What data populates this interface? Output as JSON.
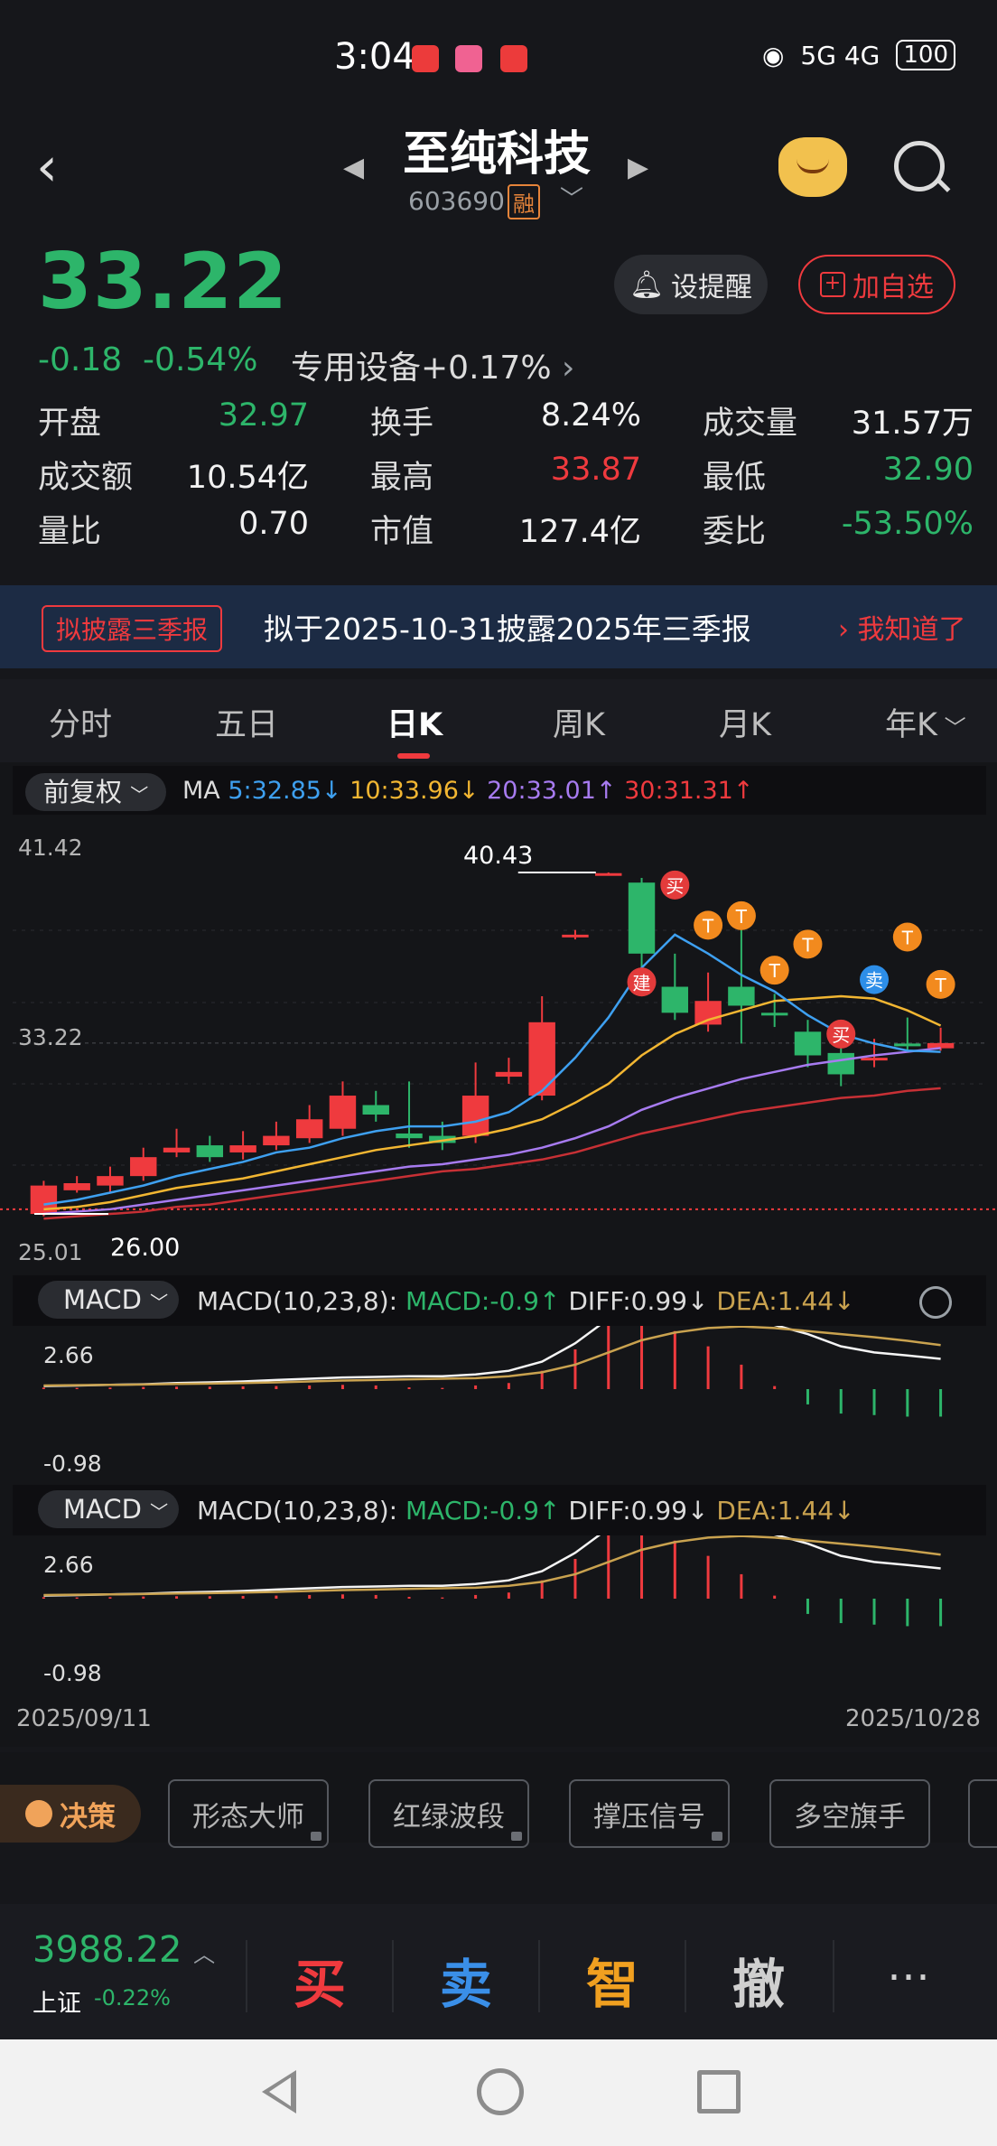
{
  "status_bar": {
    "time": "3:04",
    "network": "5G 4G",
    "battery": "100"
  },
  "header": {
    "stock_name": "至纯科技",
    "stock_code": "603690",
    "margin_badge": "融"
  },
  "quote": {
    "price": "33.22",
    "change": "-0.18",
    "change_pct": "-0.54%",
    "sector": "专用设备",
    "sector_change": "+0.17%",
    "alert_label": "设提醒",
    "watch_label": "加自选"
  },
  "stats": [
    {
      "label": "开盘",
      "value": "32.97",
      "color": "#2db56a"
    },
    {
      "label": "换手",
      "value": "8.24%",
      "color": "#f2f2f2"
    },
    {
      "label": "成交量",
      "value": "31.57万",
      "color": "#f2f2f2"
    },
    {
      "label": "成交额",
      "value": "10.54亿",
      "color": "#f2f2f2"
    },
    {
      "label": "最高",
      "value": "33.87",
      "color": "#ef3a3e"
    },
    {
      "label": "最低",
      "value": "32.90",
      "color": "#2db56a"
    },
    {
      "label": "量比",
      "value": "0.70",
      "color": "#f2f2f2"
    },
    {
      "label": "市值",
      "value": "127.4亿",
      "color": "#f2f2f2"
    },
    {
      "label": "委比",
      "value": "-53.50%",
      "color": "#2db56a"
    }
  ],
  "notice": {
    "tag": "拟披露三季报",
    "text": "拟于2025-10-31披露2025年三季报",
    "ack": "我知道了"
  },
  "tabs": [
    "分时",
    "五日",
    "日K",
    "周K",
    "月K",
    "年K"
  ],
  "active_tab": "日K",
  "chart": {
    "adjust_label": "前复权",
    "ma_label": "MA",
    "ma5": "5:32.85↓",
    "ma10": "10:33.96↓",
    "ma20": "20:33.01↑",
    "ma30": "30:31.31↑",
    "y_max": "41.42",
    "y_current": "33.22",
    "y_min": "25.01",
    "high_marker": "40.43",
    "low_marker": "26.00",
    "signal_buy": "买",
    "signal_sell": "卖",
    "signal_t": "T",
    "signal_build": "建",
    "date_start": "2025/09/11",
    "date_end": "2025/10/28"
  },
  "chart_data": {
    "type": "candlestick",
    "candles": [
      {
        "o": 26.0,
        "c": 27.2,
        "h": 27.4,
        "l": 25.9
      },
      {
        "o": 27.0,
        "c": 27.3,
        "h": 27.6,
        "l": 26.9
      },
      {
        "o": 27.2,
        "c": 27.6,
        "h": 28.0,
        "l": 26.9
      },
      {
        "o": 27.6,
        "c": 28.4,
        "h": 28.8,
        "l": 27.4
      },
      {
        "o": 28.6,
        "c": 28.8,
        "h": 29.6,
        "l": 28.4
      },
      {
        "o": 28.9,
        "c": 28.4,
        "h": 29.3,
        "l": 28.2
      },
      {
        "o": 28.6,
        "c": 28.9,
        "h": 29.5,
        "l": 28.3
      },
      {
        "o": 28.9,
        "c": 29.3,
        "h": 29.9,
        "l": 28.7
      },
      {
        "o": 29.2,
        "c": 30.0,
        "h": 30.6,
        "l": 29.0
      },
      {
        "o": 29.6,
        "c": 31.0,
        "h": 31.6,
        "l": 29.3
      },
      {
        "o": 30.6,
        "c": 30.2,
        "h": 31.2,
        "l": 29.9
      },
      {
        "o": 29.4,
        "c": 29.2,
        "h": 31.6,
        "l": 28.8
      },
      {
        "o": 29.3,
        "c": 29.0,
        "h": 29.9,
        "l": 28.7
      },
      {
        "o": 29.3,
        "c": 31.0,
        "h": 32.4,
        "l": 29.0
      },
      {
        "o": 31.8,
        "c": 32.0,
        "h": 32.6,
        "l": 31.5
      },
      {
        "o": 31.0,
        "c": 34.1,
        "h": 35.2,
        "l": 30.8
      },
      {
        "o": 37.8,
        "c": 37.8,
        "h": 38.0,
        "l": 37.6
      },
      {
        "o": 40.4,
        "c": 40.4,
        "h": 40.43,
        "l": 40.3
      },
      {
        "o": 40.0,
        "c": 37.0,
        "h": 40.2,
        "l": 36.4
      },
      {
        "o": 35.6,
        "c": 34.5,
        "h": 37.0,
        "l": 34.2
      },
      {
        "o": 34.0,
        "c": 35.0,
        "h": 36.2,
        "l": 33.7
      },
      {
        "o": 35.6,
        "c": 34.8,
        "h": 38.0,
        "l": 33.2
      },
      {
        "o": 34.5,
        "c": 34.4,
        "h": 35.3,
        "l": 33.9
      },
      {
        "o": 33.7,
        "c": 32.7,
        "h": 34.2,
        "l": 32.2
      },
      {
        "o": 32.8,
        "c": 31.9,
        "h": 33.4,
        "l": 31.4
      },
      {
        "o": 32.5,
        "c": 32.6,
        "h": 33.4,
        "l": 32.2
      },
      {
        "o": 33.2,
        "c": 33.1,
        "h": 34.3,
        "l": 32.9
      },
      {
        "o": 33.0,
        "c": 33.22,
        "h": 33.87,
        "l": 32.9
      }
    ],
    "ma5": [
      26.4,
      26.6,
      26.9,
      27.2,
      27.6,
      27.9,
      28.2,
      28.6,
      28.8,
      29.2,
      29.5,
      29.7,
      29.7,
      29.9,
      30.3,
      31.2,
      32.6,
      34.3,
      36.4,
      37.8,
      37.0,
      36.1,
      35.4,
      34.4,
      33.6,
      33.2,
      32.9,
      32.85
    ],
    "ma10": [
      26.2,
      26.3,
      26.5,
      26.8,
      27.1,
      27.3,
      27.5,
      27.8,
      28.1,
      28.4,
      28.7,
      28.9,
      29.1,
      29.3,
      29.6,
      30.0,
      30.7,
      31.5,
      32.7,
      33.6,
      34.2,
      34.6,
      35.0,
      35.1,
      35.2,
      35.1,
      34.6,
      33.96
    ],
    "ma20": [
      26.0,
      26.1,
      26.2,
      26.4,
      26.6,
      26.8,
      27.0,
      27.2,
      27.4,
      27.6,
      27.8,
      28.0,
      28.1,
      28.3,
      28.5,
      28.8,
      29.2,
      29.7,
      30.4,
      30.9,
      31.3,
      31.7,
      32.0,
      32.3,
      32.5,
      32.7,
      32.85,
      33.01
    ],
    "ma30": [
      25.8,
      25.9,
      26.0,
      26.1,
      26.3,
      26.4,
      26.6,
      26.8,
      27.0,
      27.2,
      27.4,
      27.6,
      27.8,
      27.9,
      28.1,
      28.3,
      28.6,
      29.0,
      29.4,
      29.7,
      30.0,
      30.3,
      30.5,
      30.7,
      30.9,
      31.0,
      31.2,
      31.31
    ],
    "ylim": [
      25.01,
      41.42
    ]
  },
  "macd1": {
    "label": "MACD",
    "params": "MACD(10,23,8):",
    "macd": "MACD:-0.9↑",
    "diff": "DIFF:0.99↓",
    "dea": "DEA:1.44↓",
    "y_top": "2.66",
    "y_bottom": "-0.98"
  },
  "macd2": {
    "label": "MACD",
    "params": "MACD(10,23,8):",
    "macd": "MACD:-0.9↑",
    "diff": "DIFF:0.99↓",
    "dea": "DEA:1.44↓",
    "y_top": "2.66",
    "y_bottom": "-0.98"
  },
  "macd_data": {
    "hist": [
      0.05,
      0.04,
      0.05,
      0.07,
      0.08,
      0.08,
      0.09,
      0.1,
      0.12,
      0.14,
      0.12,
      0.06,
      0.04,
      0.12,
      0.2,
      0.6,
      1.3,
      2.2,
      2.5,
      1.9,
      1.4,
      0.8,
      0.1,
      -0.5,
      -0.8,
      -0.85,
      -0.9,
      -0.9
    ],
    "diff": [
      0.1,
      0.12,
      0.14,
      0.16,
      0.2,
      0.22,
      0.25,
      0.3,
      0.34,
      0.38,
      0.4,
      0.42,
      0.42,
      0.48,
      0.6,
      0.9,
      1.5,
      2.3,
      2.66,
      2.6,
      2.5,
      2.3,
      2.1,
      1.8,
      1.4,
      1.2,
      1.1,
      0.99
    ],
    "dea": [
      0.12,
      0.13,
      0.14,
      0.15,
      0.17,
      0.18,
      0.2,
      0.22,
      0.25,
      0.28,
      0.3,
      0.32,
      0.34,
      0.36,
      0.42,
      0.55,
      0.8,
      1.2,
      1.6,
      1.85,
      2.0,
      2.05,
      2.0,
      1.9,
      1.8,
      1.7,
      1.58,
      1.44
    ]
  },
  "strategy": {
    "decision": "决策",
    "tools": [
      "形态大师",
      "红绿波段",
      "撑压信号",
      "多空旗手"
    ]
  },
  "trade_bar": {
    "index_value": "3988.22",
    "index_name": "上证",
    "index_change": "-0.22%",
    "buy": "买",
    "sell": "卖",
    "smart": "智",
    "cancel": "撤",
    "more": "⋯"
  },
  "colors": {
    "up": "#ef3a3e",
    "down": "#2db56a",
    "ma5": "#3ea0f0",
    "ma10": "#f2b632",
    "ma20": "#a77bf0",
    "ma30": "#c73035"
  }
}
